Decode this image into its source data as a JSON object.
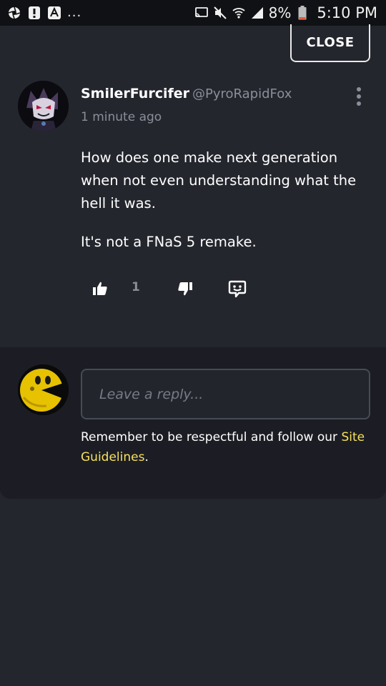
{
  "status_bar": {
    "battery": "8%",
    "time": "5:10 PM",
    "more": "..."
  },
  "close_button": {
    "label": "CLOSE"
  },
  "comment": {
    "author": "SmilerFurcifer",
    "handle": "@PyroRapidFox",
    "timestamp": "1 minute ago",
    "paragraphs": [
      "How does one make next generation when not even understanding what the hell it was.",
      "It's not a FNaS 5 remake."
    ],
    "likes": "1"
  },
  "reply": {
    "placeholder": "Leave a reply...",
    "guidelines_text": "Remember to be respectful and follow our ",
    "guidelines_link": "Site Guidelines",
    "guidelines_end": "."
  },
  "colors": {
    "background": "#24262e",
    "panel": "#1c1d24",
    "link": "#f6e05e",
    "muted": "#8a8e98"
  },
  "icons": [
    "aperture-icon",
    "alert-icon",
    "app-icon",
    "cast-icon",
    "mute-icon",
    "wifi-icon",
    "signal-icon",
    "battery-icon",
    "more-vertical-icon",
    "thumbs-up-icon",
    "thumbs-down-icon",
    "emote-icon"
  ]
}
